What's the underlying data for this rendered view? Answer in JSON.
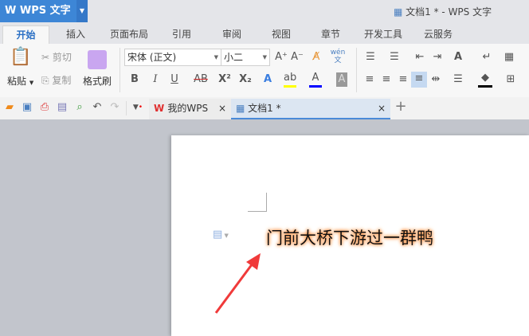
{
  "app": {
    "logo": "WPS 文字",
    "window_title": "文档1 * - WPS 文字"
  },
  "tabs": [
    {
      "label": "开始",
      "active": true
    },
    {
      "label": "插入"
    },
    {
      "label": "页面布局"
    },
    {
      "label": "引用"
    },
    {
      "label": "审阅"
    },
    {
      "label": "视图"
    },
    {
      "label": "章节"
    },
    {
      "label": "开发工具"
    },
    {
      "label": "云服务"
    }
  ],
  "ribbon": {
    "paste": "粘贴",
    "cut": "剪切",
    "copy": "复制",
    "format_painter": "格式刷",
    "font_name": "宋体 (正文)",
    "font_size": "小二",
    "bold": "B",
    "italic": "I",
    "underline": "U",
    "strike": "AB",
    "superscript": "X²",
    "subscript": "X₂",
    "pinyin": "wén",
    "highlight_color": "#ffff00",
    "font_color": "#0000ff"
  },
  "doc_tabs": [
    {
      "label": "我的WPS"
    },
    {
      "label": "文档1 *",
      "active": true
    }
  ],
  "document": {
    "text": "门前大桥下游过一群鸭"
  }
}
